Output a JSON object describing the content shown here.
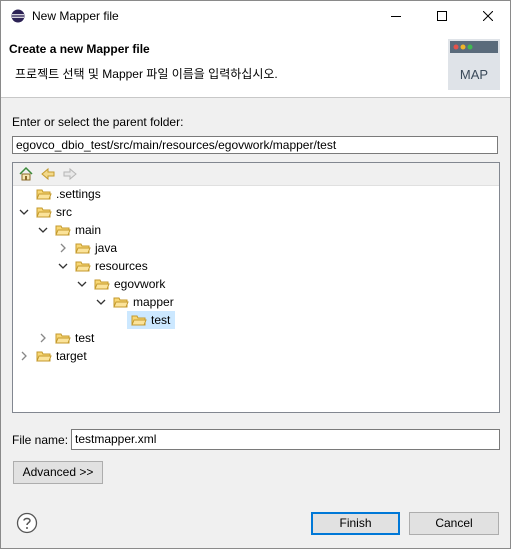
{
  "window": {
    "title": "New Mapper file"
  },
  "header": {
    "title": "Create a new Mapper file",
    "description": "프로젝트 선택 및 Mapper 파일 이름을 입력하십시오.",
    "banner_text": "MAP"
  },
  "folder": {
    "label": "Enter or select the parent folder:",
    "value": "egovco_dbio_test/src/main/resources/egovwork/mapper/test"
  },
  "tree": {
    "items": [
      {
        "label": ".settings",
        "expanded": null
      },
      {
        "label": "src",
        "expanded": true
      },
      {
        "label": "main",
        "expanded": true
      },
      {
        "label": "java",
        "expanded": false
      },
      {
        "label": "resources",
        "expanded": true
      },
      {
        "label": "egovwork",
        "expanded": true
      },
      {
        "label": "mapper",
        "expanded": true
      },
      {
        "label": "test",
        "expanded": null,
        "selected": true
      },
      {
        "label": "test",
        "expanded": false
      },
      {
        "label": "target",
        "expanded": false
      }
    ]
  },
  "file": {
    "label": "File name:",
    "value": "testmapper.xml"
  },
  "buttons": {
    "advanced": "Advanced >>",
    "finish": "Finish",
    "cancel": "Cancel"
  },
  "colors": {
    "accent": "#0078d7",
    "selection": "#cce8ff",
    "folder": "#e8b54a"
  }
}
